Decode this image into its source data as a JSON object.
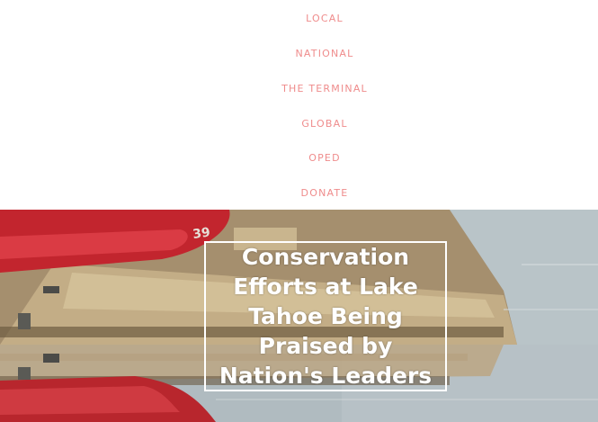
{
  "nav": {
    "items": [
      {
        "label": "LOCAL"
      },
      {
        "label": "NATIONAL"
      },
      {
        "label": "THE TERMINAL"
      },
      {
        "label": "GLOBAL"
      },
      {
        "label": "OPED"
      },
      {
        "label": "DONATE"
      }
    ],
    "color": "#ef8c8c"
  },
  "hero": {
    "headline": "Conservation Efforts at Lake Tahoe Being Praised by Nation's Leaders",
    "image_subject": "red kayaks and wooden dock reflected in lake water"
  }
}
